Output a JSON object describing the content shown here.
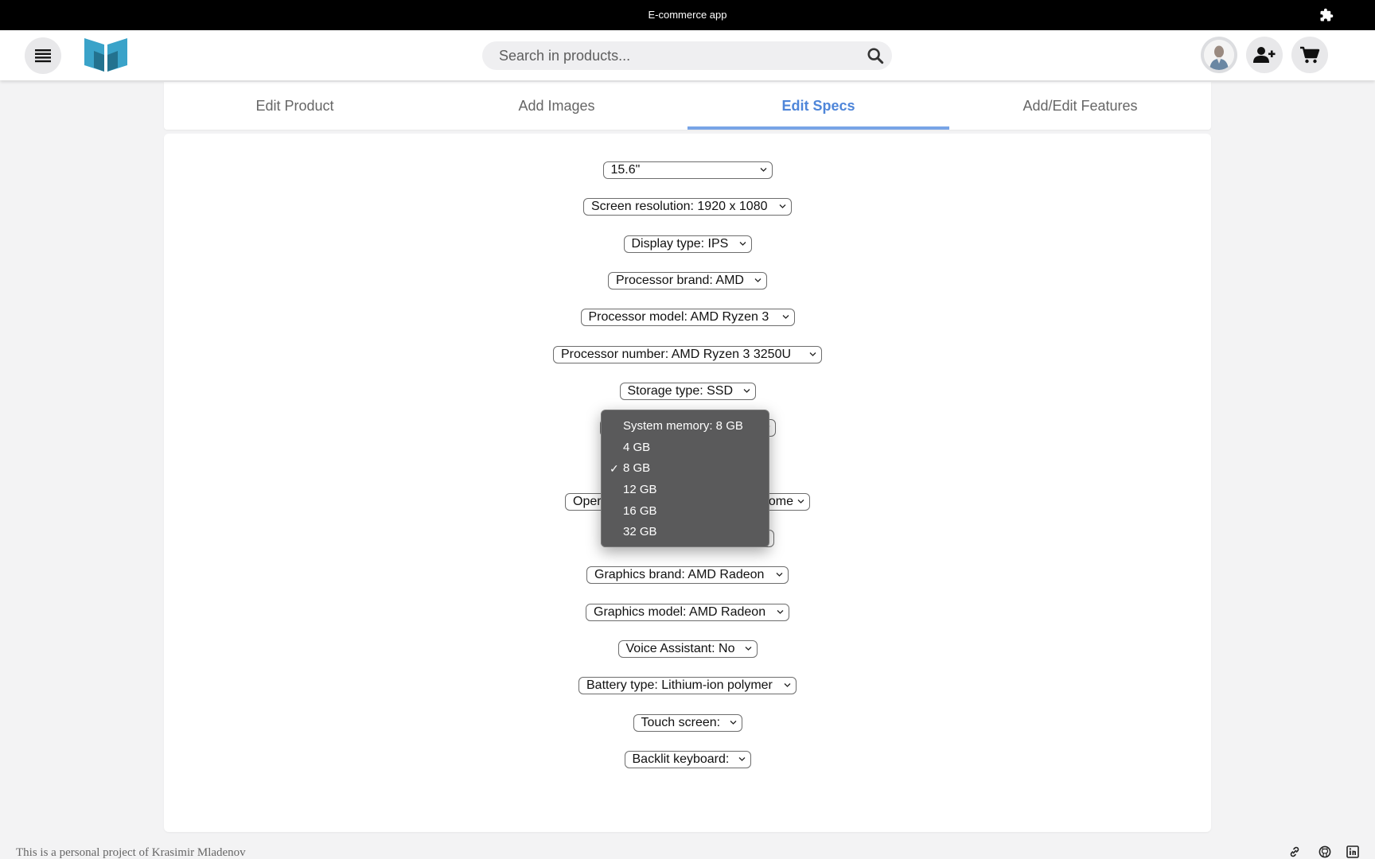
{
  "window": {
    "title": "E-commerce app",
    "extension_icon": "puzzle-icon"
  },
  "header": {
    "menu_icon": "hamburger-menu-icon",
    "logo_icon": "book-logo-icon",
    "search": {
      "placeholder": "Search in products...",
      "icon": "search-icon"
    },
    "avatar_icon": "user-avatar-icon",
    "add_user_icon": "add-user-icon",
    "cart_icon": "cart-icon"
  },
  "tabs": [
    {
      "label": "Edit Product",
      "active": false
    },
    {
      "label": "Add Images",
      "active": false
    },
    {
      "label": "Edit Specs",
      "active": true
    },
    {
      "label": "Add/Edit Features",
      "active": false
    }
  ],
  "specs": [
    {
      "label": "15.6\""
    },
    {
      "label": "Screen resolution: 1920 x 1080"
    },
    {
      "label": "Display type: IPS"
    },
    {
      "label": "Processor brand: AMD"
    },
    {
      "label": "Processor model: AMD Ryzen 3"
    },
    {
      "label": "Processor number: AMD Ryzen 3 3250U"
    },
    {
      "label": "Storage type: SSD"
    },
    {
      "label": ""
    },
    {
      "label": ""
    },
    {
      "label": "Oper",
      "suffix": "ome"
    },
    {
      "label": ""
    },
    {
      "label": "Graphics brand: AMD Radeon"
    },
    {
      "label": "Graphics model: AMD Radeon"
    },
    {
      "label": "Voice Assistant: No"
    },
    {
      "label": "Battery type: Lithium-ion polymer"
    },
    {
      "label": "Touch screen:"
    },
    {
      "label": "Backlit keyboard:"
    }
  ],
  "dropdown": {
    "options": [
      {
        "label": "System memory: 8 GB",
        "checked": false
      },
      {
        "label": "4 GB",
        "checked": false
      },
      {
        "label": "8 GB",
        "checked": true
      },
      {
        "label": "12 GB",
        "checked": false
      },
      {
        "label": "16 GB",
        "checked": false
      },
      {
        "label": "32 GB",
        "checked": false
      }
    ],
    "check_mark": "✓"
  },
  "footer": {
    "text": "This is a personal project of Krasimir Mladenov",
    "icons": [
      "link-icon",
      "github-icon",
      "linkedin-icon"
    ]
  },
  "colors": {
    "accent": "#4f86d9",
    "titlebar": "#000000",
    "popup": "#5a5a5b"
  }
}
